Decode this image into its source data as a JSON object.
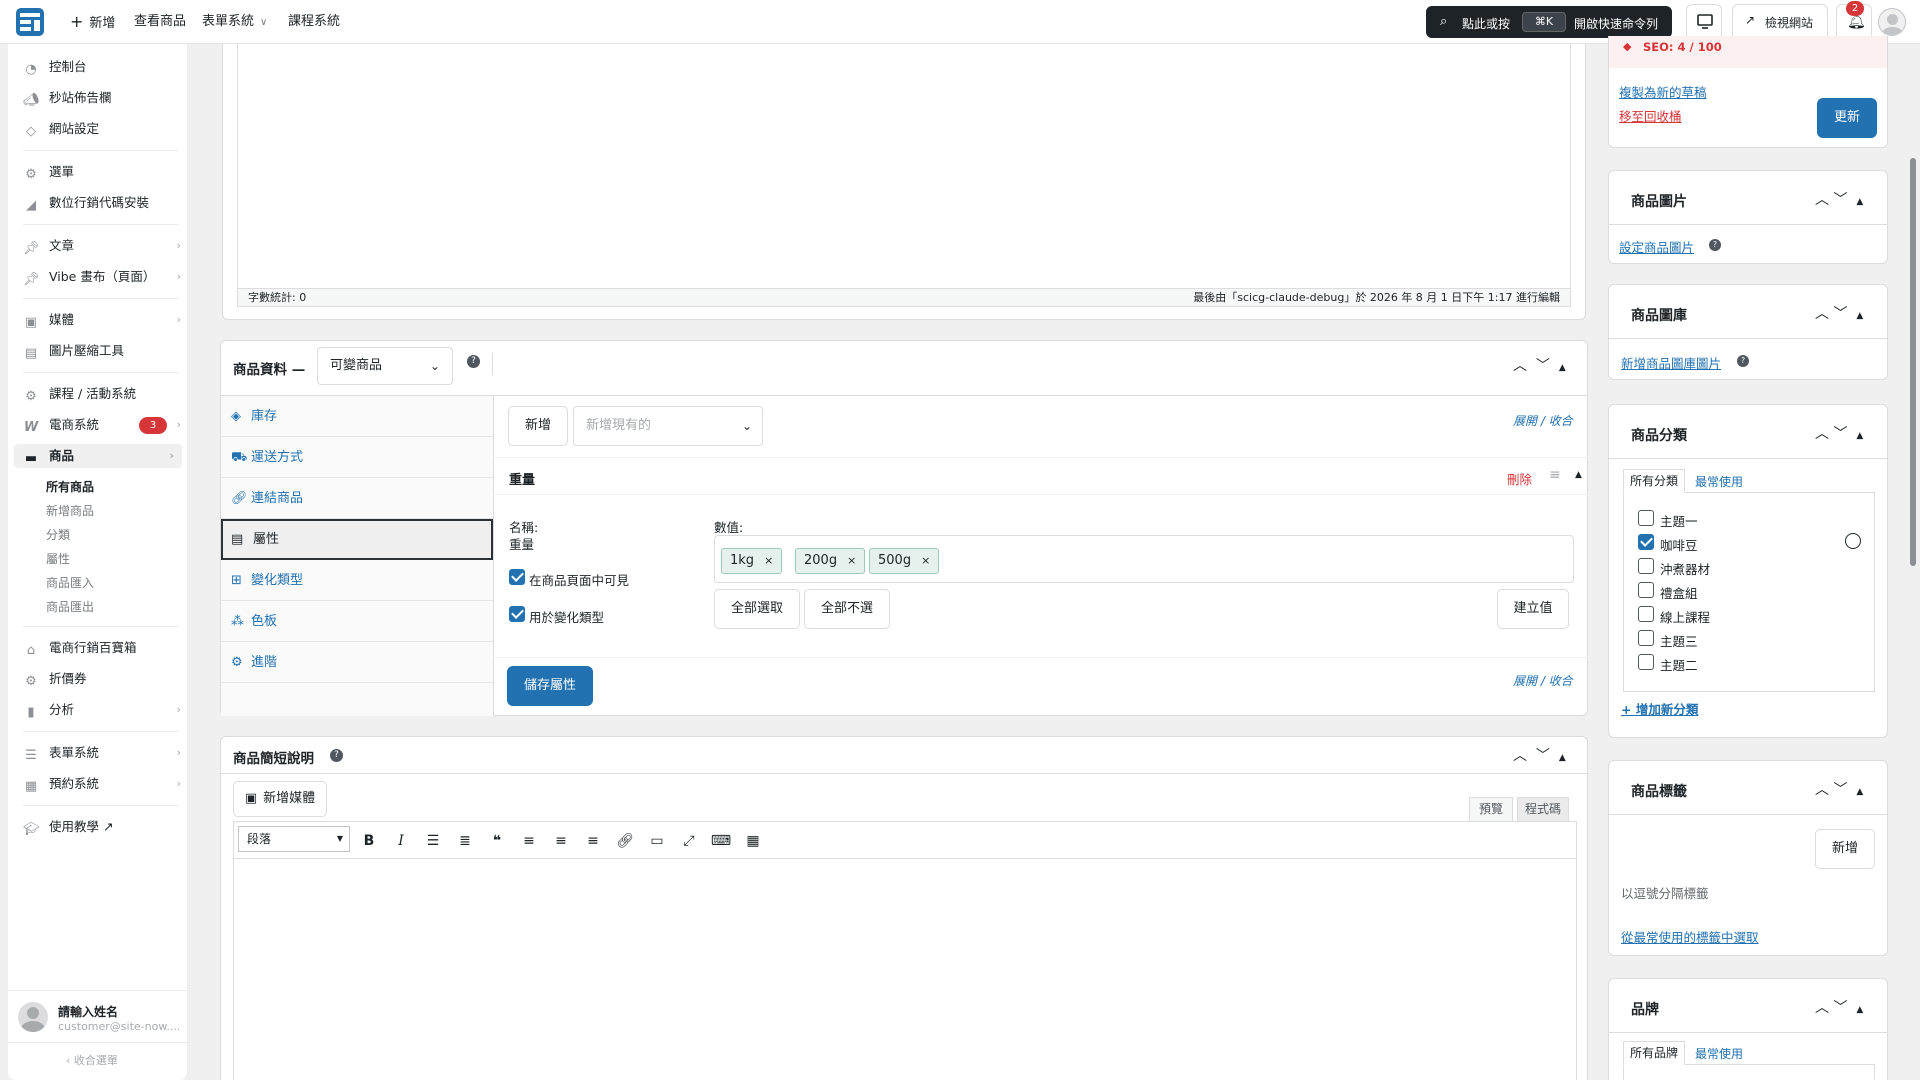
{
  "topbar": {
    "new_label": "新增",
    "view_products": "查看商品",
    "forms_system": "表單系統",
    "course_system": "課程系統",
    "cmd_click": "點此或按",
    "cmd_key": "⌘K",
    "cmd_open": "開啟快速命令列",
    "view_site": "檢視網站",
    "notification_count": "2"
  },
  "sidebar": {
    "items": [
      {
        "label": "控制台",
        "icon": "dashboard-icon"
      },
      {
        "label": "秒站佈告欄",
        "icon": "megaphone-icon"
      },
      {
        "label": "網站設定",
        "icon": "diamond-icon"
      },
      {
        "label": "選單",
        "icon": "gear-icon"
      },
      {
        "label": "數位行銷代碼安裝",
        "icon": "chart-icon"
      },
      {
        "label": "文章",
        "icon": "pin-icon"
      },
      {
        "label": "Vibe 畫布（頁面）",
        "icon": "pin-icon"
      },
      {
        "label": "媒體",
        "icon": "media-icon"
      },
      {
        "label": "圖片壓縮工具",
        "icon": "document-icon"
      },
      {
        "label": "課程 / 活動系統",
        "icon": "gear-icon"
      },
      {
        "label": "電商系統",
        "icon": "woo-icon",
        "badge": "3"
      },
      {
        "label": "商品",
        "icon": "archive-icon"
      },
      {
        "label": "電商行銷百寶箱",
        "icon": "store-icon"
      },
      {
        "label": "折價券",
        "icon": "gear-icon"
      },
      {
        "label": "分析",
        "icon": "bar-chart-icon"
      },
      {
        "label": "表單系統",
        "icon": "form-icon"
      },
      {
        "label": "預約系統",
        "icon": "calendar-icon"
      },
      {
        "label": "使用教學 ↗",
        "icon": "graduation-icon"
      }
    ],
    "subitems": [
      "所有商品",
      "新增商品",
      "分類",
      "屬性",
      "商品匯入",
      "商品匯出"
    ],
    "user_name": "請輸入姓名",
    "user_email": "customer@site-now....",
    "collapse": "收合選單"
  },
  "editor": {
    "word_count": "字數統計: 0",
    "last_edited": "最後由「scicg-claude-debug」於 2026 年 8 月 1 日下午 1:17 進行編輯"
  },
  "product_data": {
    "title": "商品資料 —",
    "type": "可變商品",
    "tabs": [
      "庫存",
      "運送方式",
      "連結商品",
      "屬性",
      "變化類型",
      "色板",
      "進階"
    ],
    "add_button": "新增",
    "existing_placeholder": "新增現有的",
    "expand_collapse": "展開 / 收合",
    "attribute_name_display": "重量",
    "delete": "刪除",
    "name_label": "名稱:",
    "name_value": "重量",
    "values_label": "數值:",
    "values": [
      "1kg",
      "200g",
      "500g"
    ],
    "visible_label": "在商品頁面中可見",
    "variation_label": "用於變化類型",
    "select_all": "全部選取",
    "select_none": "全部不選",
    "create_value": "建立值",
    "save_attributes": "儲存屬性"
  },
  "short_desc": {
    "title": "商品簡短說明",
    "add_media": "新增媒體",
    "tab_visual": "預覽",
    "tab_code": "程式碼",
    "format": "段落"
  },
  "right": {
    "seo": "SEO: 4 / 100",
    "copy_draft": "複製為新的草稿",
    "trash": "移至回收桶",
    "update": "更新",
    "product_image_title": "商品圖片",
    "set_image": "設定商品圖片",
    "gallery_title": "商品圖庫",
    "add_gallery": "新增商品圖庫圖片",
    "category_title": "商品分類",
    "cat_tab_all": "所有分類",
    "cat_tab_common": "最常使用",
    "categories": [
      {
        "name": "主題一",
        "checked": false
      },
      {
        "name": "咖啡豆",
        "checked": true
      },
      {
        "name": "沖煮器材",
        "checked": false
      },
      {
        "name": "禮盒組",
        "checked": false
      },
      {
        "name": "線上課程",
        "checked": false
      },
      {
        "name": "主題三",
        "checked": false
      },
      {
        "name": "主題二",
        "checked": false
      }
    ],
    "add_category": "+ 增加新分類",
    "tags_title": "商品標籤",
    "tag_add": "新增",
    "tag_hint": "以逗號分隔標籤",
    "tag_choose": "從最常使用的標籤中選取",
    "brand_title": "品牌",
    "brand_tab_all": "所有品牌",
    "brand_tab_common": "最常使用"
  },
  "colors": {
    "accent": "#2271b1",
    "danger": "#d63638",
    "dark": "#1d2327"
  }
}
